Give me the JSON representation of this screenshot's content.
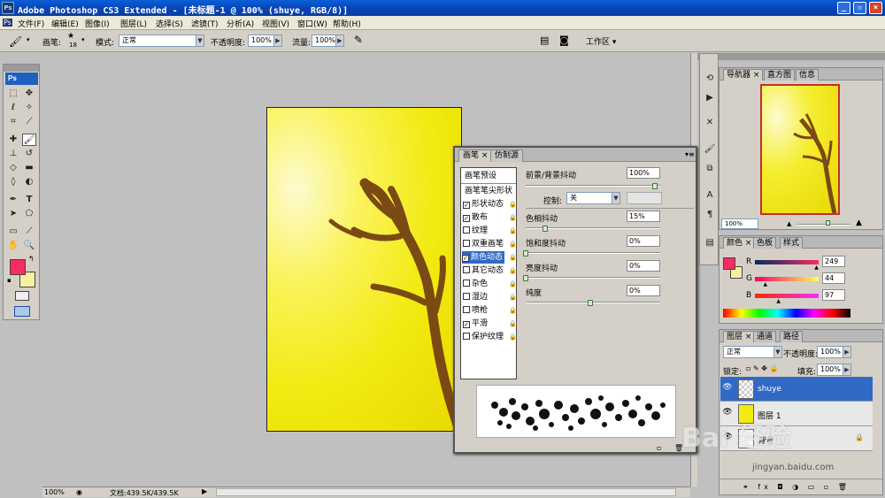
{
  "window": {
    "title": "Adobe Photoshop CS3 Extended - [未标题-1 @ 100% (shuye, RGB/8)]",
    "min": "_",
    "restore": "▫",
    "close": "×"
  },
  "menu": [
    "文件(F)",
    "编辑(E)",
    "图像(I)",
    "图层(L)",
    "选择(S)",
    "滤镜(T)",
    "分析(A)",
    "视图(V)",
    "窗口(W)",
    "帮助(H)"
  ],
  "options": {
    "brush_label": "画笔:",
    "brush_size": "18",
    "mode_label": "模式:",
    "mode_value": "正常",
    "opacity_label": "不透明度:",
    "opacity_value": "100%",
    "flow_label": "流量:",
    "flow_value": "100%",
    "workspace": "工作区 ▾"
  },
  "brush_panel": {
    "tabs": [
      "画笔",
      "仿制源"
    ],
    "presets": "画笔预设",
    "tip_shape": "画笔笔尖形状",
    "items": [
      {
        "label": "形状动态",
        "checked": true
      },
      {
        "label": "散布",
        "checked": true
      },
      {
        "label": "纹理",
        "checked": false
      },
      {
        "label": "双重画笔",
        "checked": false
      },
      {
        "label": "颜色动态",
        "checked": true,
        "selected": true
      },
      {
        "label": "其它动态",
        "checked": false
      },
      {
        "label": "杂色",
        "checked": false
      },
      {
        "label": "湿边",
        "checked": false
      },
      {
        "label": "喷枪",
        "checked": false
      },
      {
        "label": "平滑",
        "checked": true
      },
      {
        "label": "保护纹理",
        "checked": false
      }
    ],
    "fg_bg_jitter_label": "前景/背景抖动",
    "fg_bg_jitter_value": "100%",
    "fg_bg_jitter_level": 1.0,
    "control_label": "控制:",
    "control_value": "关",
    "hue_label": "色相抖动",
    "hue_value": "15%",
    "hue_level": 0.15,
    "sat_label": "饱和度抖动",
    "sat_value": "0%",
    "sat_level": 0,
    "bright_label": "亮度抖动",
    "bright_value": "0%",
    "bright_level": 0,
    "purity_label": "纯度",
    "purity_value": "0%",
    "purity_level": 0.5
  },
  "navigator": {
    "tabs": [
      "导航器",
      "直方图",
      "信息"
    ],
    "zoom": "100%"
  },
  "color_panel": {
    "tabs": [
      "颜色",
      "色板",
      "样式"
    ],
    "r_label": "R",
    "g_label": "G",
    "b_label": "B",
    "r": "249",
    "g": "44",
    "b": "97",
    "r_level": 0.976,
    "g_level": 0.173,
    "b_level": 0.38,
    "fg_color": "#f92c61",
    "bg_color": "#f8f0a0"
  },
  "layers_panel": {
    "tabs": [
      "图层",
      "通道",
      "路径"
    ],
    "blend_mode": "正常",
    "opacity_label": "不透明度:",
    "opacity_value": "100%",
    "lock_label": "锁定:",
    "fill_label": "填充:",
    "fill_value": "100%",
    "layers": [
      {
        "name": "shuye"
      },
      {
        "name": "图层 1"
      },
      {
        "name": "背景"
      }
    ]
  },
  "status": {
    "zoom": "100%",
    "doc": "文档:439.5K/439.5K"
  },
  "watermark": "Bai 经验",
  "watermark_url": "jingyan.baidu.com"
}
